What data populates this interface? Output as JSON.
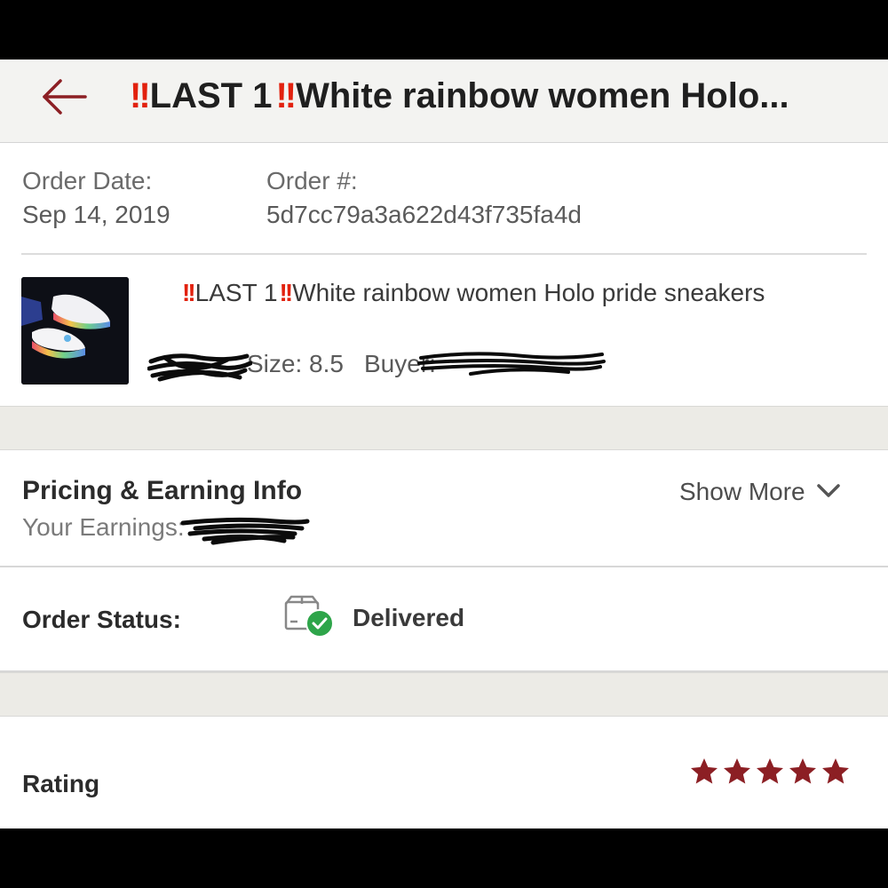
{
  "header": {
    "back_icon": "arrow-left-icon",
    "title_prefix": "LAST 1",
    "title_rest": "White rainbow women Holo...",
    "accent_color": "#e2210e"
  },
  "order": {
    "date_label": "Order Date:",
    "date_value": "Sep 14, 2019",
    "number_label": "Order #:",
    "number_value": "5d7cc79a3a622d43f735fa4d"
  },
  "item": {
    "title_prefix": "LAST 1",
    "title_rest": "White rainbow women Holo pride sneakers",
    "size_text": "Size: 8.5",
    "buyer_label": "Buyer:"
  },
  "pricing": {
    "title": "Pricing & Earning Info",
    "show_more": "Show More",
    "earnings_label": "Your Earnings:"
  },
  "status": {
    "label": "Order Status:",
    "value": "Delivered",
    "icon": "package-delivered-icon",
    "check_color": "#2ea54a"
  },
  "rating": {
    "label": "Rating",
    "stars": 5,
    "star_color": "#8c1f24"
  }
}
